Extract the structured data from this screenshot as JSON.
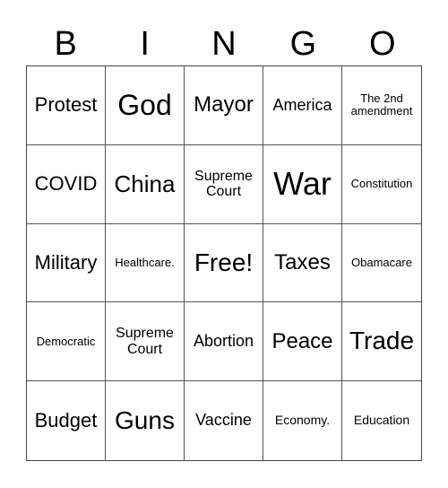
{
  "header": [
    "B",
    "I",
    "N",
    "G",
    "O"
  ],
  "cells": [
    "Protest",
    "God",
    "Mayor",
    "America",
    "The 2nd amendment",
    "COVID",
    "China",
    "Supreme Court",
    "War",
    "Constitution",
    "Military",
    "Healthcare.",
    "Free!",
    "Taxes",
    "Obamacare",
    "Democratic",
    "Supreme Court",
    "Abortion",
    "Peace",
    "Trade",
    "Budget",
    "Guns",
    "Vaccine",
    "Economy.",
    "Education"
  ]
}
